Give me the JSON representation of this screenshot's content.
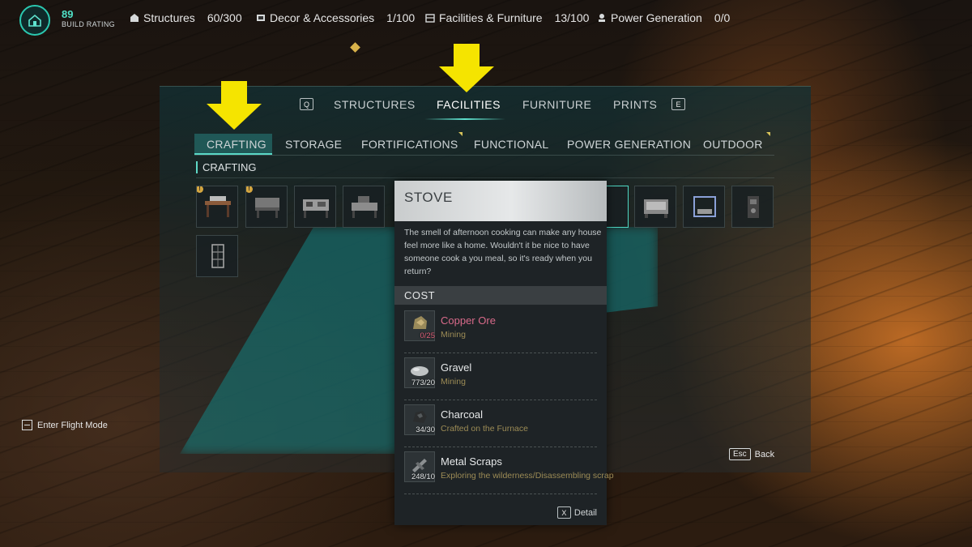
{
  "hud": {
    "build_rating_value": "89",
    "build_rating_label": "BUILD RATING",
    "stats": [
      {
        "label": "Structures",
        "value": "60/300",
        "icon": "structure-icon"
      },
      {
        "label": "Decor & Accessories",
        "value": "1/100",
        "icon": "decor-icon"
      },
      {
        "label": "Facilities & Furniture",
        "value": "13/100",
        "icon": "facilities-icon"
      },
      {
        "label": "Power Generation",
        "value": "0/0",
        "icon": "power-icon"
      }
    ]
  },
  "main_tabs": {
    "prev_key": "Q",
    "next_key": "E",
    "items": [
      "STRUCTURES",
      "FACILITIES",
      "FURNITURE",
      "PRINTS"
    ],
    "active": "FACILITIES"
  },
  "sub_tabs": {
    "items": [
      "CRAFTING",
      "STORAGE",
      "FORTIFICATIONS",
      "FUNCTIONAL",
      "POWER GENERATION",
      "OUTDOOR"
    ],
    "active": "CRAFTING"
  },
  "section": {
    "title": "CRAFTING"
  },
  "tooltip": {
    "title": "STOVE",
    "description": "The smell of afternoon cooking can make any house feel more like a home. Wouldn't it be nice to have someone cook a you meal, so it's ready when you return?",
    "cost_label": "COST",
    "costs": [
      {
        "name": "Copper Ore",
        "source": "Mining",
        "count": "0/25",
        "insufficient": true
      },
      {
        "name": "Gravel",
        "source": "Mining",
        "count": "773/20",
        "insufficient": false
      },
      {
        "name": "Charcoal",
        "source": "Crafted on the Furnace",
        "count": "34/30",
        "insufficient": false
      },
      {
        "name": "Metal Scraps",
        "source": "Exploring the wilderness/Disassembling scrap",
        "count": "248/10",
        "insufficient": false
      }
    ],
    "detail_key": "X",
    "detail_label": "Detail"
  },
  "hints": {
    "flight_label": "Enter Flight Mode",
    "back_key": "Esc",
    "back_label": "Back"
  },
  "colors": {
    "accent": "#5fe3cf",
    "arrow": "#f5e400",
    "insufficient": "#d86a8a",
    "source_text": "#9c8b55"
  }
}
